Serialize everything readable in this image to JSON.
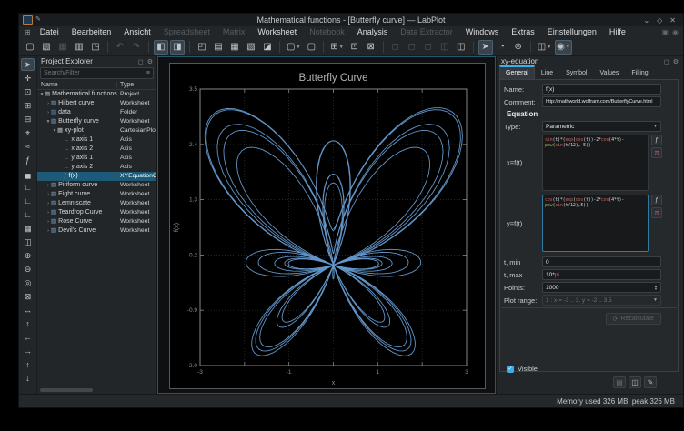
{
  "window": {
    "title": "Mathematical functions - [Butterfly curve] — LabPlot",
    "minimize_glyph": "⌄",
    "maximize_glyph": "◇",
    "close_glyph": "✕",
    "pencil_glyph": "✎"
  },
  "menubar": {
    "lead_icon_glyph": "⊞",
    "items": [
      {
        "label": "Datei",
        "enabled": true
      },
      {
        "label": "Bearbeiten",
        "enabled": true
      },
      {
        "label": "Ansicht",
        "enabled": true
      },
      {
        "label": "Spreadsheet",
        "enabled": false
      },
      {
        "label": "Matrix",
        "enabled": false
      },
      {
        "label": "Worksheet",
        "enabled": true
      },
      {
        "label": "Notebook",
        "enabled": false
      },
      {
        "label": "Analysis",
        "enabled": true
      },
      {
        "label": "Data Extractor",
        "enabled": false
      },
      {
        "label": "Windows",
        "enabled": true
      },
      {
        "label": "Extras",
        "enabled": true
      },
      {
        "label": "Einstellungen",
        "enabled": true
      },
      {
        "label": "Hilfe",
        "enabled": true
      }
    ],
    "right_icons": [
      {
        "name": "menubar-extra-icon-1",
        "glyph": "▣"
      },
      {
        "name": "menubar-extra-icon-2",
        "glyph": "◉"
      }
    ]
  },
  "toolbar": {
    "groups": [
      [
        {
          "name": "new-project-button",
          "glyph": "▢"
        },
        {
          "name": "open-project-button",
          "glyph": "▧"
        },
        {
          "name": "save-project-button",
          "glyph": "▦",
          "state": "disabled"
        },
        {
          "name": "print-button",
          "glyph": "▥"
        },
        {
          "name": "print-preview-button",
          "glyph": "◳"
        }
      ],
      [
        {
          "name": "undo-button",
          "glyph": "↶",
          "state": "disabled"
        },
        {
          "name": "redo-button",
          "glyph": "↷",
          "state": "disabled"
        }
      ],
      [
        {
          "name": "toggle-project-explorer-button",
          "glyph": "◧",
          "state": "checked"
        },
        {
          "name": "toggle-properties-explorer-button",
          "glyph": "◨",
          "state": "checked"
        }
      ],
      [
        {
          "name": "new-workbook-button",
          "glyph": "◰"
        },
        {
          "name": "new-spreadsheet-button",
          "glyph": "▤"
        },
        {
          "name": "new-matrix-button",
          "glyph": "▦"
        },
        {
          "name": "new-worksheet-button",
          "glyph": "▧"
        },
        {
          "name": "new-notebook-button",
          "glyph": "◪"
        }
      ],
      [
        {
          "name": "import-file-dropdown-button",
          "glyph": "▢",
          "dropdown": true
        },
        {
          "name": "import-sql-button",
          "glyph": "▢"
        }
      ],
      [
        {
          "name": "zoom-dropdown-button",
          "glyph": "⊞",
          "dropdown": true
        },
        {
          "name": "zoom-fit-button",
          "glyph": "⊡"
        },
        {
          "name": "zoom-select-button",
          "glyph": "⊠"
        }
      ],
      [
        {
          "name": "spreadsheet-tool-button-1",
          "glyph": "◻",
          "state": "disabled"
        },
        {
          "name": "spreadsheet-tool-button-2",
          "glyph": "◻",
          "state": "disabled"
        },
        {
          "name": "spreadsheet-tool-button-3",
          "glyph": "◻",
          "state": "disabled"
        },
        {
          "name": "spreadsheet-tool-button-4",
          "glyph": "◫",
          "state": "disabled"
        },
        {
          "name": "worksheet-grid-button",
          "glyph": "◫"
        }
      ],
      [
        {
          "name": "pointer-mode-button",
          "glyph": "➤",
          "state": "checked"
        },
        {
          "name": "zoom-mode-button",
          "glyph": "◔"
        },
        {
          "name": "magnification-button",
          "glyph": "⊛"
        }
      ],
      [
        {
          "name": "cartesian-plot-dropdown-button",
          "glyph": "◫",
          "dropdown": true
        },
        {
          "name": "add-xy-curve-dropdown-button",
          "glyph": "◉",
          "dropdown": true,
          "state": "checked"
        }
      ]
    ]
  },
  "plot_toolbar": {
    "buttons": [
      {
        "name": "select-edit-mode-button",
        "glyph": "➤",
        "state": "checked"
      },
      {
        "name": "navigate-mode-button",
        "glyph": "✛"
      },
      {
        "name": "zoom-select-mode-button",
        "glyph": "⊡"
      },
      {
        "name": "zoom-x-select-mode-button",
        "glyph": "⊞"
      },
      {
        "name": "zoom-y-select-mode-button",
        "glyph": "⊟"
      },
      {
        "name": "cursor-mode-button",
        "glyph": "⌖"
      },
      {
        "name": "add-curve-button",
        "glyph": "≈"
      },
      {
        "name": "add-equation-curve-button",
        "glyph": "ƒ"
      },
      {
        "name": "add-histogram-button",
        "glyph": "▄"
      },
      {
        "name": "add-x-axis-button",
        "glyph": "∟"
      },
      {
        "name": "add-y-axis-button",
        "glyph": "∟"
      },
      {
        "name": "add-axis-button",
        "glyph": "∟"
      },
      {
        "name": "add-legend-button",
        "glyph": "▦"
      },
      {
        "name": "add-text-label-button",
        "glyph": "◫"
      },
      {
        "name": "zoom-in-button",
        "glyph": "⊕"
      },
      {
        "name": "zoom-out-button",
        "glyph": "⊖"
      },
      {
        "name": "zoom-origin-button",
        "glyph": "◎"
      },
      {
        "name": "auto-scale-button",
        "glyph": "⊠"
      },
      {
        "name": "auto-scale-x-button",
        "glyph": "↔"
      },
      {
        "name": "auto-scale-y-button",
        "glyph": "↕"
      },
      {
        "name": "shift-left-button",
        "glyph": "←"
      },
      {
        "name": "shift-right-button",
        "glyph": "→"
      },
      {
        "name": "shift-up-button",
        "glyph": "↑"
      },
      {
        "name": "shift-down-button",
        "glyph": "↓"
      }
    ]
  },
  "project_explorer": {
    "title": "Project Explorer",
    "float_icon_glyph": "◻",
    "menu_icon_glyph": "⚙",
    "search_placeholder": "Search/Filter",
    "filter_icon_glyph": "≡",
    "columns": [
      "Name",
      "Type"
    ],
    "rows": [
      {
        "name": "Mathematical functions",
        "type": "Project",
        "depth": 0,
        "expanded": true,
        "icon": "project"
      },
      {
        "name": "Hilbert curve",
        "type": "Worksheet",
        "depth": 1,
        "expanded": false,
        "icon": "worksheet"
      },
      {
        "name": "data",
        "type": "Folder",
        "depth": 1,
        "expanded": false,
        "icon": "folder"
      },
      {
        "name": "Butterfly curve",
        "type": "Worksheet",
        "depth": 1,
        "expanded": true,
        "icon": "worksheet"
      },
      {
        "name": "xy-plot",
        "type": "CartesianPlot",
        "depth": 2,
        "expanded": true,
        "icon": "plot"
      },
      {
        "name": "x axis 1",
        "type": "Axis",
        "depth": 3,
        "icon": "axis"
      },
      {
        "name": "x axis 2",
        "type": "Axis",
        "depth": 3,
        "icon": "axis"
      },
      {
        "name": "y axis 1",
        "type": "Axis",
        "depth": 3,
        "icon": "axis"
      },
      {
        "name": "y axis 2",
        "type": "Axis",
        "depth": 3,
        "icon": "axis"
      },
      {
        "name": "f(x)",
        "type": "XYEquationCurve",
        "depth": 3,
        "icon": "equation-curve",
        "selected": true
      },
      {
        "name": "Piriform curve",
        "type": "Worksheet",
        "depth": 1,
        "expanded": false,
        "icon": "worksheet"
      },
      {
        "name": "Eight curve",
        "type": "Worksheet",
        "depth": 1,
        "expanded": false,
        "icon": "worksheet"
      },
      {
        "name": "Lemniscate",
        "type": "Worksheet",
        "depth": 1,
        "expanded": false,
        "icon": "worksheet"
      },
      {
        "name": "Teardrop Curve",
        "type": "Worksheet",
        "depth": 1,
        "expanded": false,
        "icon": "worksheet"
      },
      {
        "name": "Rose Curve",
        "type": "Worksheet",
        "depth": 1,
        "expanded": false,
        "icon": "worksheet"
      },
      {
        "name": "Devil's Curve",
        "type": "Worksheet",
        "depth": 1,
        "expanded": false,
        "icon": "worksheet"
      }
    ]
  },
  "chart_data": {
    "type": "line",
    "title": "Butterfly Curve",
    "xlabel": "x",
    "ylabel": "f(x)",
    "xlim": [
      -3,
      3
    ],
    "ylim": [
      -2,
      3.5
    ],
    "grid": true,
    "x_ticks": [
      -3,
      -2,
      -1,
      0,
      1,
      2,
      3
    ],
    "x_tick_labels": [
      "-3",
      "",
      "-1",
      "",
      "1",
      "",
      "3"
    ],
    "y_ticks": [
      -2,
      -0.9,
      0.2,
      1.3,
      2.4,
      3.5
    ],
    "y_tick_labels": [
      "-2.0",
      "-0.9",
      "0.2",
      "1.3",
      "2.4",
      "3.5"
    ],
    "grid_x": [
      -2,
      -1,
      0,
      1,
      2
    ],
    "grid_y": [
      -0.9,
      0.2,
      1.3,
      2.4
    ],
    "series": [
      {
        "name": "f(x)",
        "color": "#6aa2d8",
        "parametric": {
          "x": "sin(t)*(exp(cos(t))-2*cos(4*t)-pow(sin(t/12), 5))",
          "y": "cos(t)*(exp(cos(t))-2*cos(4*t)-pow(sin(t/12),5))",
          "t_min": "0",
          "t_max": "10*pi",
          "points": 1000
        }
      }
    ]
  },
  "properties": {
    "title": "xy-equation",
    "float_icon_glyph": "◻",
    "menu_icon_glyph": "⚙",
    "tabs": [
      {
        "label": "General",
        "active": true
      },
      {
        "label": "Line",
        "active": false
      },
      {
        "label": "Symbol",
        "active": false
      },
      {
        "label": "Values",
        "active": false
      },
      {
        "label": "Filling",
        "active": false
      }
    ],
    "name_label": "Name:",
    "name_value": "f(x)",
    "comment_label": "Comment:",
    "comment_value": "http://mathworld.wolfram.com/ButterflyCurve.html",
    "equation_heading": "Equation",
    "type_label": "Type:",
    "type_value": "Parametric",
    "x_label": "x=f(t)",
    "x_value": "sin(t)*(exp(cos(t))-2*cos(4*t)-pow(sin(t/12), 5))",
    "y_label": "y=f(t)",
    "y_value": "cos(t)*(exp(cos(t))-2*cos(4*t)-pow(sin(t/12),5))",
    "functions_button_glyph": "ƒ",
    "pi_button_glyph": "π",
    "tmin_label": "t, min",
    "tmin_value": "0",
    "tmax_label": "t, max",
    "tmax_value": "10*pi",
    "points_label": "Points:",
    "points_value": "1000",
    "plot_range_label": "Plot range:",
    "plot_range_value": "1 : x = -3 .. 3, y = -2 .. 3.5",
    "recalculate_glyph": "⟳",
    "recalculate_label": "Recalculate",
    "visible_label": "Visible",
    "footer_icons": [
      {
        "name": "load-template-button",
        "glyph": "▤",
        "dim": true
      },
      {
        "name": "save-template-button",
        "glyph": "◫",
        "dim": false
      },
      {
        "name": "save-as-default-button",
        "glyph": "✎",
        "dim": false
      }
    ]
  },
  "statusbar": {
    "memory": "Memory used 326 MB, peak 326 MB"
  }
}
